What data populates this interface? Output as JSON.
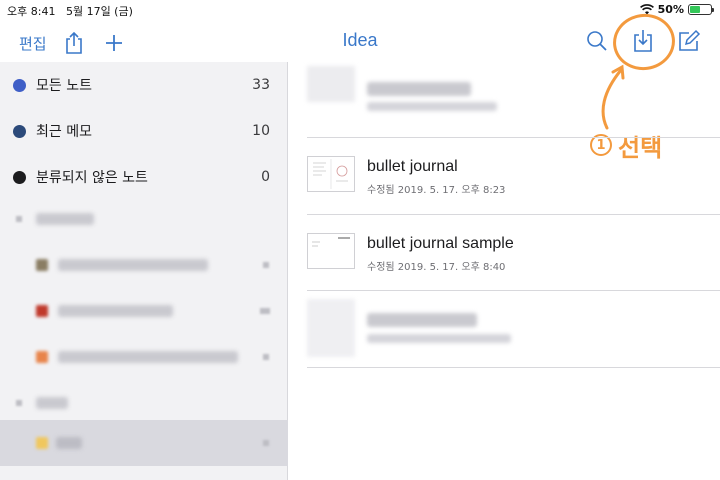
{
  "status_bar": {
    "time": "오후 8:41",
    "date": "5월 17일 (금)",
    "battery": "50%"
  },
  "nav": {
    "edit_label": "편집",
    "title": "Idea"
  },
  "sidebar": {
    "items": [
      {
        "label": "모든 노트",
        "count": "33",
        "color": "#3f5fc7"
      },
      {
        "label": "최근 메모",
        "count": "10",
        "color": "#2c4a7a"
      },
      {
        "label": "분류되지 않은 노트",
        "count": "0",
        "color": "#1c1c1e"
      }
    ]
  },
  "notes": [
    {
      "title": "bullet journal",
      "subtitle": "수정됨 2019. 5. 17. 오후 8:23"
    },
    {
      "title": "bullet journal sample",
      "subtitle": "수정됨 2019. 5. 17. 오후 8:40"
    }
  ],
  "annotation": {
    "number": "1",
    "text": "선택",
    "color": "#f39a3e"
  },
  "icons": [
    "wifi-icon",
    "battery-icon",
    "share-icon",
    "plus-icon",
    "search-icon",
    "import-icon",
    "compose-icon"
  ]
}
